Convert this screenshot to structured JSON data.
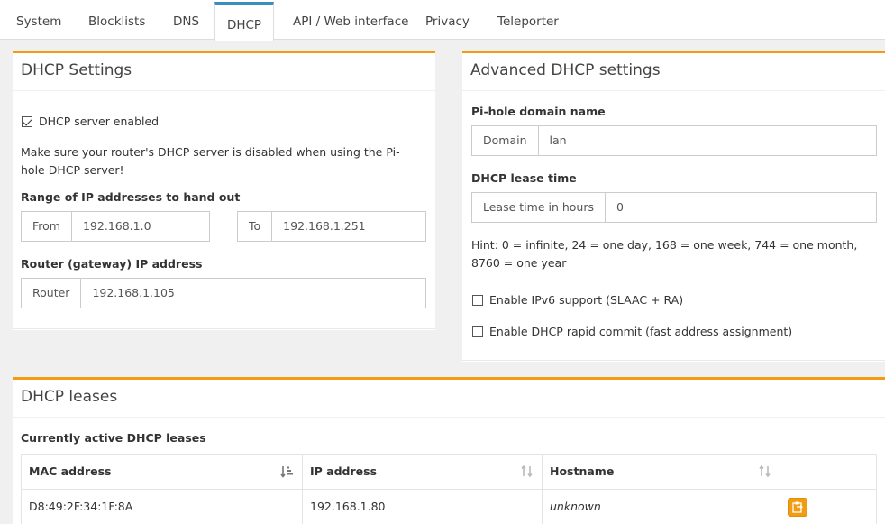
{
  "tabs": [
    {
      "label": "System",
      "active": false
    },
    {
      "label": "Blocklists",
      "active": false
    },
    {
      "label": "DNS",
      "active": false
    },
    {
      "label": "DHCP",
      "active": true
    },
    {
      "label": "API / Web interface",
      "active": false
    },
    {
      "label": "Privacy",
      "active": false
    },
    {
      "label": "Teleporter",
      "active": false
    }
  ],
  "dhcp_settings": {
    "title": "DHCP Settings",
    "enabled_label": "DHCP server enabled",
    "enabled": true,
    "note": "Make sure your router's DHCP server is disabled when using the Pi-hole DHCP server!",
    "range_label": "Range of IP addresses to hand out",
    "from_addon": "From",
    "from_value": "192.168.1.0",
    "to_addon": "To",
    "to_value": "192.168.1.251",
    "router_label": "Router (gateway) IP address",
    "router_addon": "Router",
    "router_value": "192.168.1.105"
  },
  "advanced": {
    "title": "Advanced DHCP settings",
    "domain_label": "Pi-hole domain name",
    "domain_addon": "Domain",
    "domain_value": "lan",
    "lease_label": "DHCP lease time",
    "lease_addon": "Lease time in hours",
    "lease_value": "0",
    "hint": "Hint: 0 = infinite, 24 = one day, 168 = one week, 744 = one month, 8760 = one year",
    "ipv6_label": "Enable IPv6 support (SLAAC + RA)",
    "ipv6_enabled": false,
    "rapid_label": "Enable DHCP rapid commit (fast address assignment)",
    "rapid_enabled": false
  },
  "leases": {
    "title": "DHCP leases",
    "subtitle": "Currently active DHCP leases",
    "columns": [
      "MAC address",
      "IP address",
      "Hostname"
    ],
    "rows": [
      {
        "mac": "D8:49:2F:34:1F:8A",
        "ip": "192.168.1.80",
        "hostname": "unknown"
      }
    ]
  },
  "colors": {
    "accent": "#f39c12",
    "tab_active": "#3c8dbc"
  }
}
